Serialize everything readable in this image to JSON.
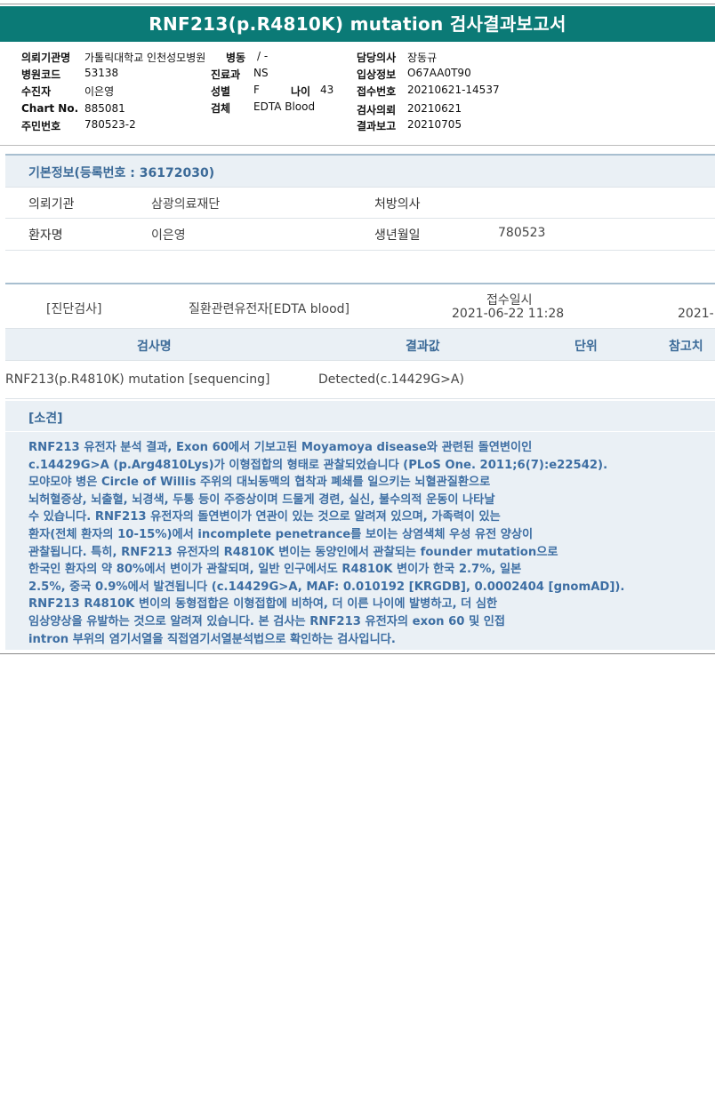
{
  "report": {
    "title": "RNF213(p.R4810K) mutation 검사결과보고서"
  },
  "header": {
    "left": [
      {
        "label": "의뢰기관명",
        "value": "가톨릭대학교 인천성모병원"
      },
      {
        "label": "병원코드",
        "value": "53138"
      },
      {
        "label": "수진자",
        "value": "이은영"
      },
      {
        "label": "Chart No.",
        "value": "885081"
      },
      {
        "label": "주민번호",
        "value": "780523-2"
      }
    ],
    "ward": {
      "label": "병동",
      "value": "/ -"
    },
    "dept": {
      "label": "진료과",
      "value": "NS"
    },
    "sex": {
      "label": "성별",
      "value": "F"
    },
    "age": {
      "label": "나이",
      "value": "43"
    },
    "specimen": {
      "label": "검체",
      "value": "EDTA Blood"
    },
    "right": [
      {
        "label": "담당의사",
        "value": "장동규"
      },
      {
        "label": "입상정보",
        "value": "O67AA0T90"
      },
      {
        "label": "접수번호",
        "value": "20210621-14537"
      },
      {
        "label": "검사의뢰",
        "value": "20210621"
      },
      {
        "label": "결과보고",
        "value": "20210705"
      }
    ]
  },
  "basic_info": {
    "title": "기본정보(등록번호 : 36172030)",
    "institution_label": "의뢰기관",
    "institution_value": "삼광의료재단",
    "doctor_label": "처방의사",
    "doctor_value": "",
    "patient_label": "환자명",
    "patient_value": "이은영",
    "birth_label": "생년월일",
    "birth_value": "780523"
  },
  "order": {
    "category": "[진단검사]",
    "test_group": "질환관련유전자[EDTA blood]",
    "received_label": "접수일시",
    "received_value": "2021-06-22  11:28",
    "next_value": "2021-"
  },
  "results_table": {
    "headers": [
      "검사명",
      "결과값",
      "단위",
      "참고치"
    ],
    "rows": [
      {
        "name": "RNF213(p.R4810K) mutation [sequencing]",
        "result": "Detected(c.14429G>A)",
        "unit": "",
        "ref": ""
      }
    ]
  },
  "comments": {
    "title": "[소견]",
    "lines": [
      "RNF213 유전자 분석 결과, Exon 60에서 기보고된 Moyamoya disease와 관련된 돌연변이인",
      "c.14429G>A (p.Arg4810Lys)가 이형접합의 형태로 관찰되었습니다 (PLoS One. 2011;6(7):e22542).",
      "모야모야 병은 Circle of Willis 주위의 대뇌동맥의 협착과 폐쇄를 일으키는 뇌혈관질환으로",
      "뇌허혈증상, 뇌출혈, 뇌경색, 두통 등이 주증상이며 드물게 경련, 실신, 불수의적 운동이 나타날",
      "수 있습니다. RNF213 유전자의 돌연변이가 연관이 있는 것으로 알려져 있으며, 가족력이 있는",
      "환자(전체 환자의 10-15%)에서 incomplete penetrance를 보이는 상염색체 우성 유전 양상이",
      "관찰됩니다. 특히, RNF213 유전자의 R4810K 변이는 동양인에서 관찰되는 founder mutation으로",
      "한국인 환자의 약 80%에서 변이가 관찰되며, 일반 인구에서도 R4810K 변이가 한국 2.7%, 일본",
      "2.5%, 중국 0.9%에서 발견됩니다 (c.14429G>A, MAF: 0.010192 [KRGDB], 0.0002404 [gnomAD]).",
      "RNF213 R4810K 변이의 동형접합은 이형접합에 비하여, 더 이른 나이에 발병하고, 더 심한",
      "임상양상을 유발하는 것으로 알려져 있습니다. 본 검사는 RNF213 유전자의 exon 60 및 인접",
      "intron 부위의 염기서열을 직접염기서열분석법으로 확인하는 검사입니다."
    ]
  }
}
